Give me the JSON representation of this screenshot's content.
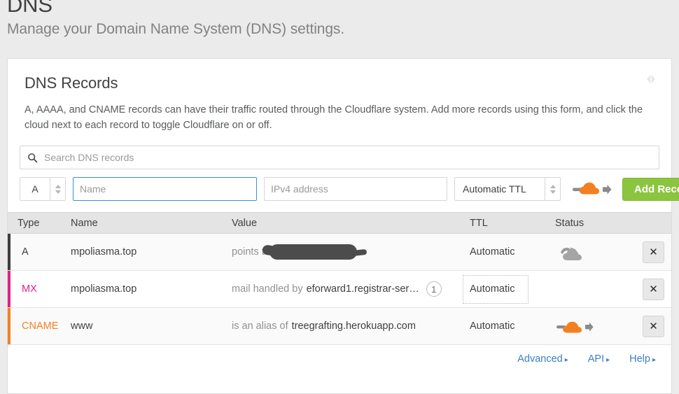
{
  "page": {
    "title": "DNS",
    "subtitle": "Manage your Domain Name System (DNS) settings."
  },
  "card": {
    "title": "DNS Records",
    "description": "A, AAAA, and CNAME records can have their traffic routed through the Cloudflare system. Add more records using this form, and click the cloud next to each record to toggle Cloudflare on or off.",
    "collapse_icon": "collapse-expand-icon"
  },
  "search": {
    "icon": "search-icon",
    "placeholder": "Search DNS records",
    "value": ""
  },
  "add_form": {
    "type_value": "A",
    "name_placeholder": "Name",
    "name_value": "",
    "address_placeholder": "IPv4 address",
    "address_value": "",
    "ttl_value": "Automatic TTL",
    "cloud_icon": "orange-cloud-proxied-icon",
    "submit_label": "Add Record"
  },
  "table": {
    "columns": [
      "Type",
      "Name",
      "Value",
      "TTL",
      "Status"
    ],
    "rows": [
      {
        "type": "A",
        "type_color": "#404041",
        "accent_color": "#3d3d3d",
        "name": "mpoliasma.top",
        "value_label": "points to",
        "value_data": "",
        "value_redacted": true,
        "priority": "",
        "ttl": "Automatic",
        "ttl_focused": false,
        "status_icon": "grey-cloud-dns-only-icon",
        "delete_label": "✕"
      },
      {
        "type": "MX",
        "type_color": "#e0218a",
        "accent_color": "#e0218a",
        "name": "mpoliasma.top",
        "value_label": "mail handled by",
        "value_data": "eforward1.registrar-ser…",
        "value_redacted": false,
        "priority": "1",
        "ttl": "Automatic",
        "ttl_focused": true,
        "status_icon": "none",
        "delete_label": "✕"
      },
      {
        "type": "CNAME",
        "type_color": "#f38020",
        "accent_color": "#f38020",
        "name": "www",
        "value_label": "is an alias of",
        "value_data": "treegrafting.herokuapp.com",
        "value_redacted": false,
        "priority": "",
        "ttl": "Automatic",
        "ttl_focused": false,
        "status_icon": "orange-cloud-proxied-icon",
        "delete_label": "✕"
      }
    ]
  },
  "footer": {
    "links": [
      {
        "label": "Advanced",
        "caret": "▸"
      },
      {
        "label": "API",
        "caret": "▸"
      },
      {
        "label": "Help",
        "caret": "▸"
      }
    ]
  },
  "colors": {
    "accent_green": "#8bc53f",
    "cloudflare_orange": "#f38020",
    "mx_pink": "#e0218a",
    "link_blue": "#3b7fc4",
    "focus_blue": "#3a8dde"
  }
}
